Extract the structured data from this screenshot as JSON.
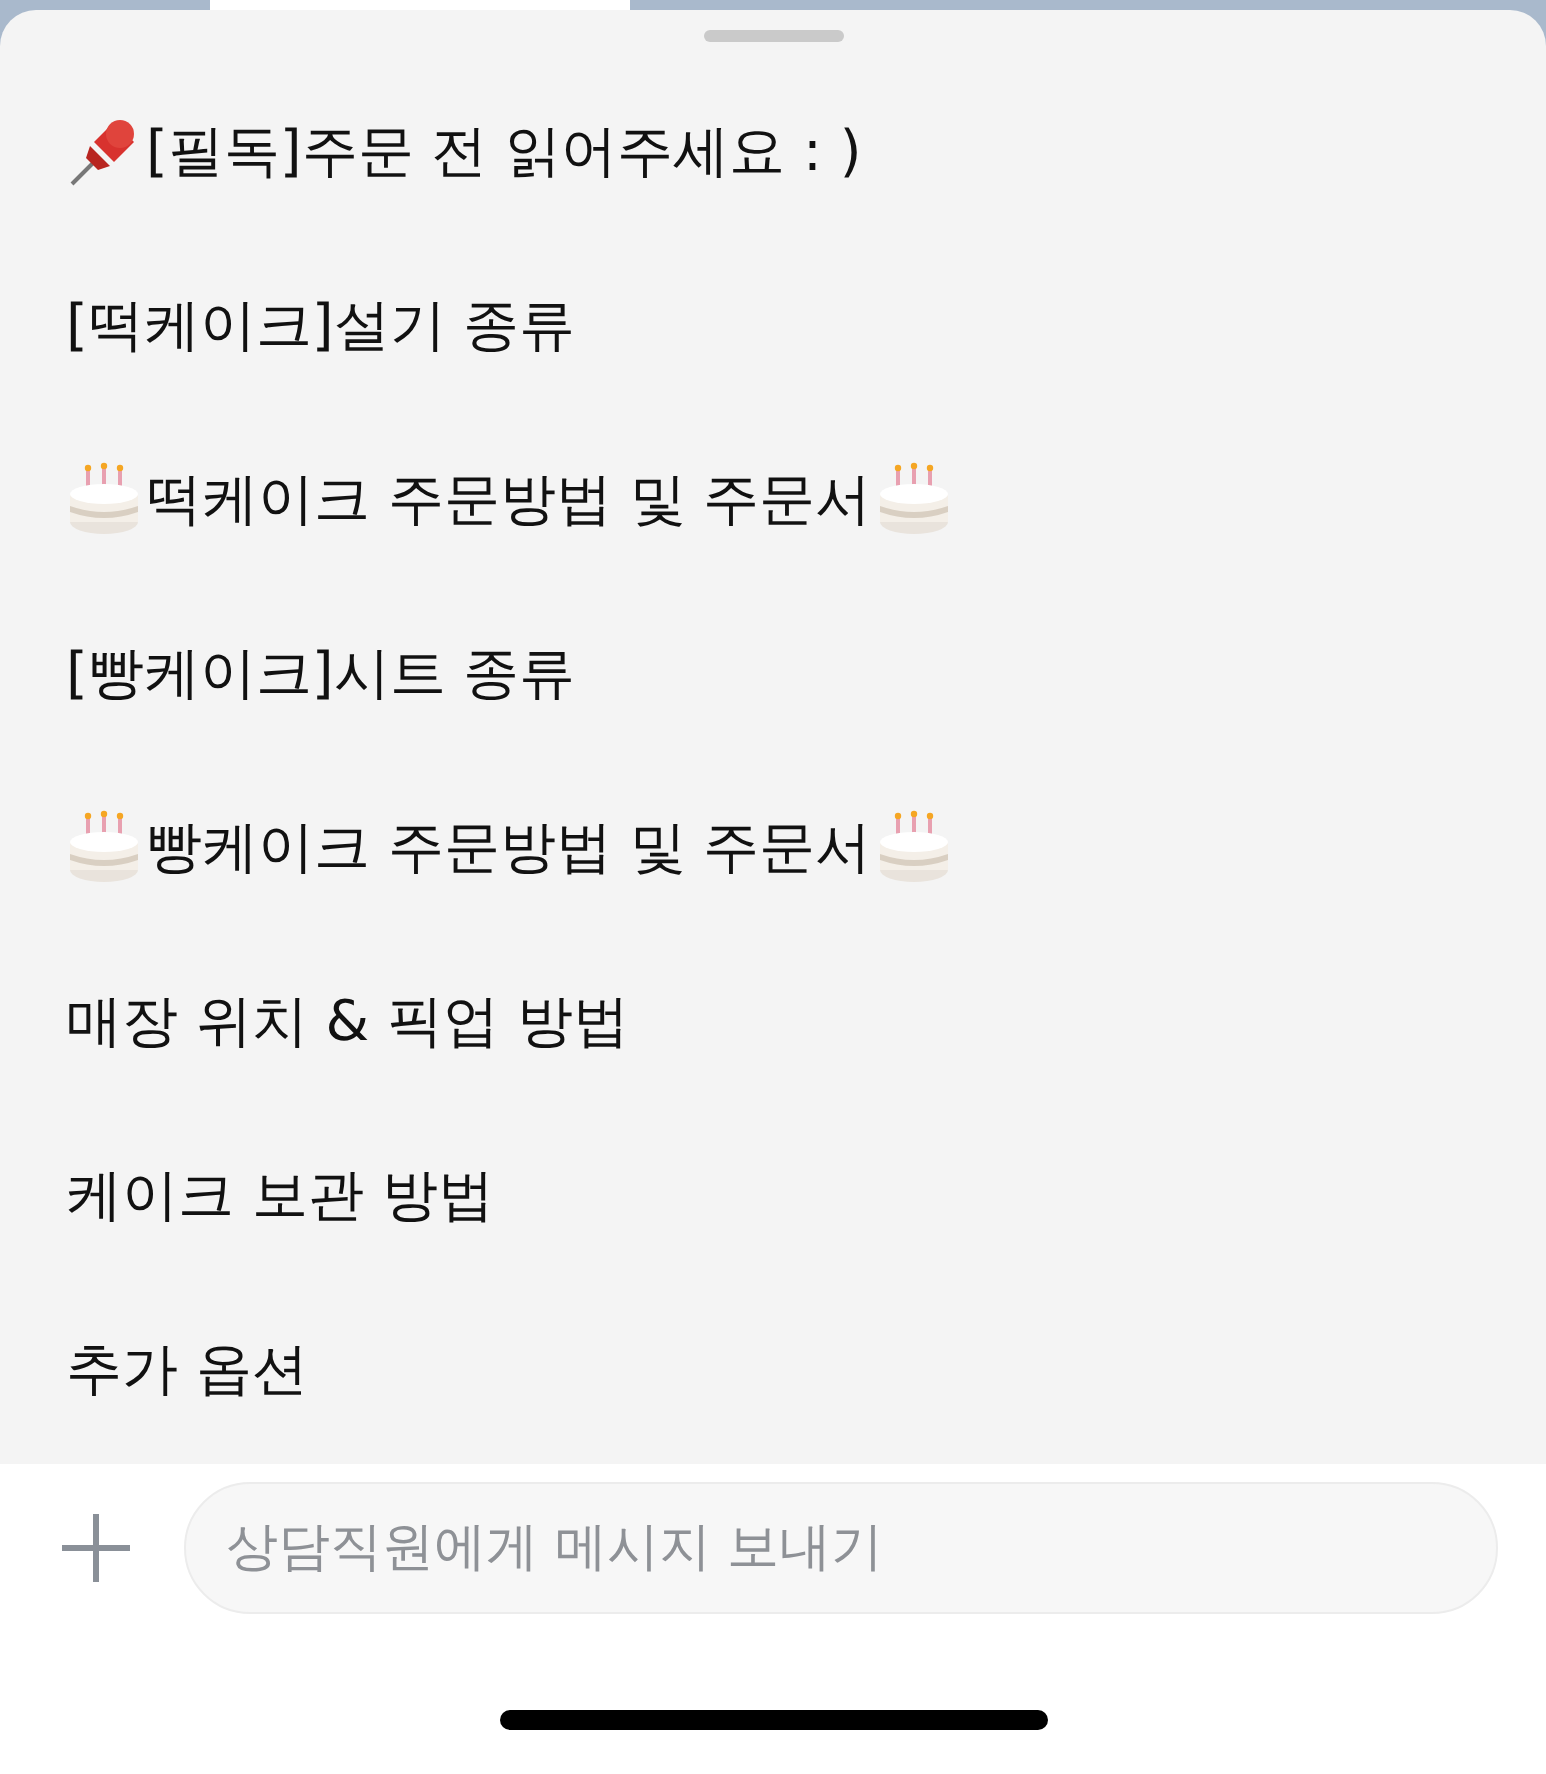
{
  "menu": {
    "items": [
      {
        "kind": "pinned",
        "text": "[필독]주문 전 읽어주세요 : )"
      },
      {
        "kind": "plain",
        "text": "[떡케이크]설기 종류"
      },
      {
        "kind": "cake",
        "text": "떡케이크 주문방법 및 주문서"
      },
      {
        "kind": "plain",
        "text": "[빵케이크]시트 종류"
      },
      {
        "kind": "cake",
        "text": "빵케이크 주문방법 및 주문서"
      },
      {
        "kind": "plain",
        "text": "매장 위치 & 픽업 방법"
      },
      {
        "kind": "plain",
        "text": "케이크 보관 방법"
      },
      {
        "kind": "plain",
        "text": "추가 옵션"
      }
    ]
  },
  "composer": {
    "placeholder": "상담직원에게 메시지 보내기"
  }
}
